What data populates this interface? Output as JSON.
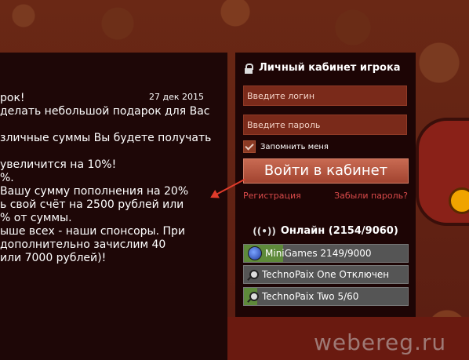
{
  "article": {
    "date": "27 дек 2015",
    "lines": [
      "рок!",
      "делать небольшой подарок для Вас",
      "",
      "зличные суммы Вы будете получать",
      "",
      "увеличится на 10%!",
      "%.",
      "Вашу сумму пополнения на 20%",
      "ь свой счёт на 2500 рублей или",
      "% от суммы.",
      "ыше всех - наши спонсоры. При",
      "дополнительно зачислим 40",
      "или 7000 рублей)!"
    ]
  },
  "login": {
    "title": "Личный кабинет игрока",
    "login_placeholder": "Введите логин",
    "password_placeholder": "Введите пароль",
    "remember_label": "Запомнить меня",
    "remember_checked": true,
    "submit_label": "Войти в кабинет",
    "register_link": "Регистрация",
    "forgot_link": "Забыли пароль?"
  },
  "online": {
    "title": "Онлайн (2154/9060)",
    "servers": [
      {
        "label": "MiniGames 2149/9000",
        "icon": "globe-icon",
        "fill_fraction": 0.24
      },
      {
        "label": "TechnoPaix One Отключен",
        "icon": "search-icon",
        "fill_fraction": 0.0
      },
      {
        "label": "TechnoPaix Two 5/60",
        "icon": "search-icon",
        "fill_fraction": 0.08
      }
    ]
  },
  "watermark": "webereg.ru",
  "colors": {
    "accent_red": "#d94a4a",
    "button": "#b5553d",
    "online_fill": "#5e8a3a"
  }
}
